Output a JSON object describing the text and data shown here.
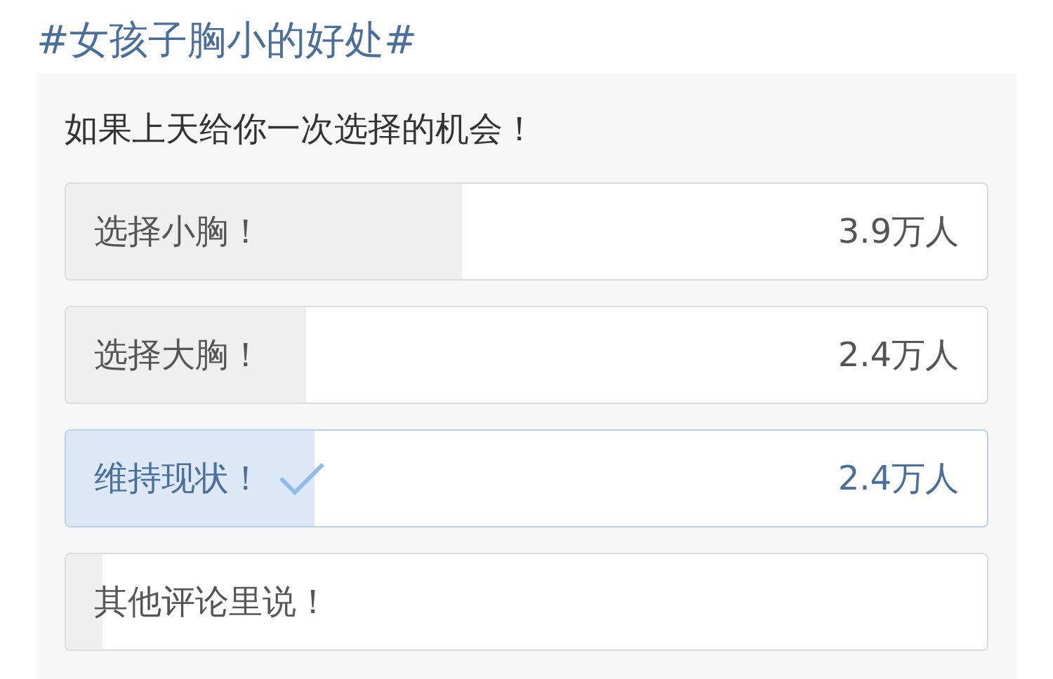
{
  "topic": "#女孩子胸小的好处#",
  "poll": {
    "question": "如果上天给你一次选择的机会！",
    "options": [
      {
        "label": "选择小胸！",
        "count": "3.9万人",
        "level": 0.43,
        "selected": false
      },
      {
        "label": "选择大胸！",
        "count": "2.4万人",
        "level": 0.26,
        "selected": false
      },
      {
        "label": "维持现状！",
        "count": "2.4万人",
        "level": 0.27,
        "selected": true
      },
      {
        "label": "其他评论里说！",
        "level": 0.04,
        "selected": false
      }
    ]
  }
}
